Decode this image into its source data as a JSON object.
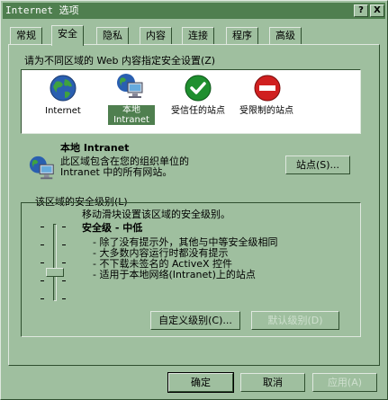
{
  "window": {
    "title": "Internet 选项"
  },
  "titlebar_buttons": {
    "help": "?",
    "close": "X"
  },
  "tabs": [
    {
      "label": "常规"
    },
    {
      "label": "安全"
    },
    {
      "label": "隐私"
    },
    {
      "label": "内容"
    },
    {
      "label": "连接"
    },
    {
      "label": "程序"
    },
    {
      "label": "高级"
    }
  ],
  "zones_prompt": "请为不同区域的 Web 内容指定安全设置(Z)",
  "zones": [
    {
      "label": "Internet",
      "icon": "globe-icon"
    },
    {
      "label": "本地 Intranet",
      "icon": "intranet-icon",
      "selected": true
    },
    {
      "label": "受信任的站点",
      "icon": "trusted-check-icon"
    },
    {
      "label": "受限制的站点",
      "icon": "restricted-icon"
    }
  ],
  "zone_info": {
    "title": "本地 Intranet",
    "description_line1": "此区域包含在您的组织单位的",
    "description_line2": "Intranet 中的所有网站。",
    "sites_button": "站点(S)..."
  },
  "security_level": {
    "group_label": "该区域的安全级别(L)",
    "instruction": "移动滑块设置该区域的安全级别。",
    "level_name": "安全级 - 中低",
    "bullets": [
      "- 除了没有提示外，其他与中等安全级相同",
      "- 大多数内容运行时都没有提示",
      "- 不下载未签名的 ActiveX 控件",
      "- 适用于本地网络(Intranet)上的站点"
    ],
    "slider_level": "中低",
    "custom_button": "自定义级别(C)...",
    "default_button": "默认级别(D)"
  },
  "footer": {
    "ok": "确定",
    "cancel": "取消",
    "apply": "应用(A)"
  },
  "colors": {
    "background": "#9fbf9f",
    "titlebar": "#4f7f4f",
    "selection": "#4f7f4f"
  }
}
